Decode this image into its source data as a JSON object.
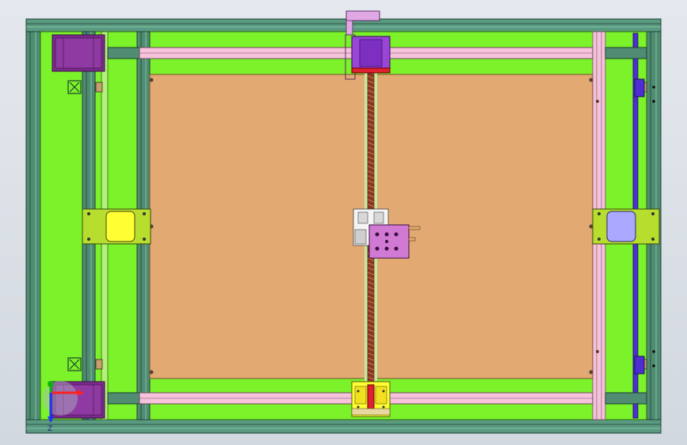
{
  "viewport": {
    "background": "#dfe3ea",
    "colors": {
      "board": "#e2aa72",
      "frame_fill": "#7cf22a",
      "extrusion": "#4f8c72",
      "extrusion_dark": "#2e5e4a",
      "rail_pink": "#f7c3dc",
      "stepper_purple": "#7a2b8c",
      "carriage_violet": "#9b45d6",
      "plate_lime": "#b7dd2e",
      "block_yellow": "#ffff33",
      "block_lavender": "#aaa8ff",
      "leadscrew": "#8a3a22",
      "spindle_plate": "#d07ad4",
      "axis_x": "#ff2020",
      "axis_y": "#10b010",
      "axis_z": "#2030ff"
    },
    "icons": {
      "triad": "coordinate-triad-icon",
      "motor": "stepper-motor-icon",
      "bracket": "corner-bracket-icon"
    }
  },
  "triad": {
    "axis_label": "Z"
  }
}
